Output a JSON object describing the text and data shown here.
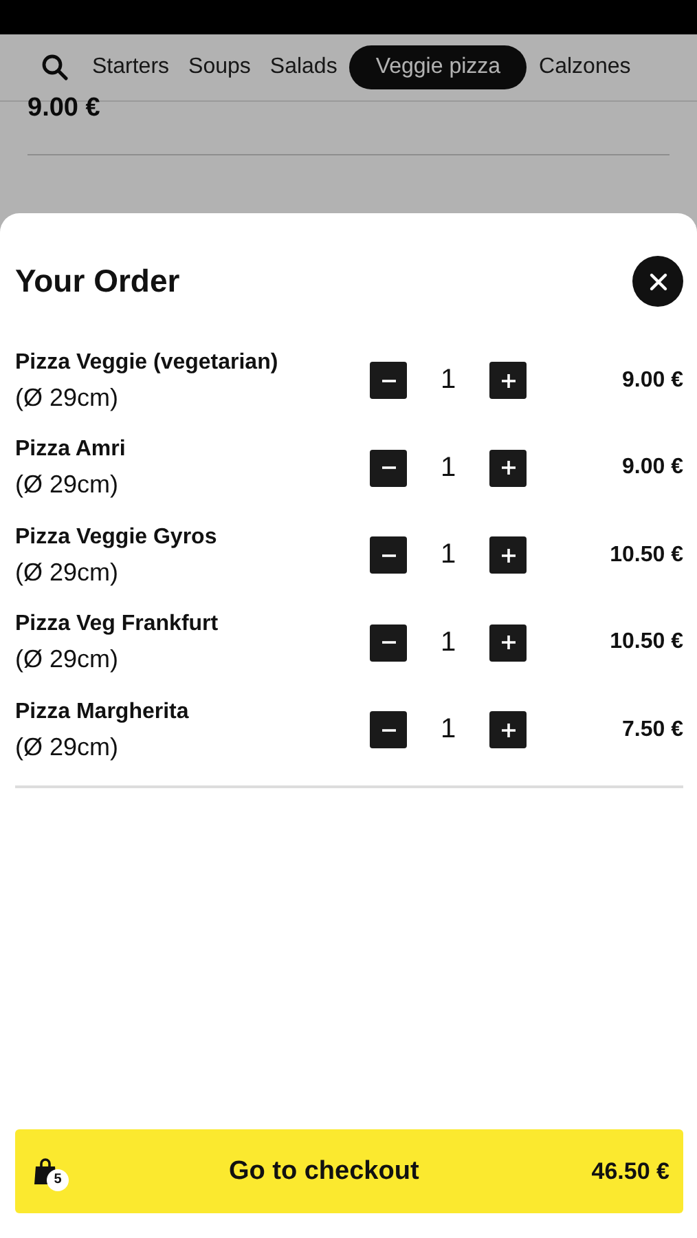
{
  "tabs": [
    {
      "label": "Starters",
      "selected": false
    },
    {
      "label": "Soups",
      "selected": false
    },
    {
      "label": "Salads",
      "selected": false
    },
    {
      "label": "Veggie pizza",
      "selected": true
    },
    {
      "label": "Calzones",
      "selected": false
    }
  ],
  "background_price": "9.00 €",
  "order": {
    "title": "Your Order",
    "items": [
      {
        "name": "Pizza Veggie (vegetarian)",
        "size": "(Ø 29cm)",
        "quantity": "1",
        "price": "9.00 €"
      },
      {
        "name": "Pizza Amri",
        "size": "(Ø 29cm)",
        "quantity": "1",
        "price": "9.00 €"
      },
      {
        "name": "Pizza Veggie Gyros",
        "size": "(Ø 29cm)",
        "quantity": "1",
        "price": "10.50 €"
      },
      {
        "name": "Pizza Veg Frankfurt",
        "size": "(Ø 29cm)",
        "quantity": "1",
        "price": "10.50 €"
      },
      {
        "name": "Pizza Margherita",
        "size": "(Ø 29cm)",
        "quantity": "1",
        "price": "7.50 €"
      }
    ],
    "checkout": {
      "label": "Go to checkout",
      "count": "5",
      "total": "46.50 €"
    }
  }
}
